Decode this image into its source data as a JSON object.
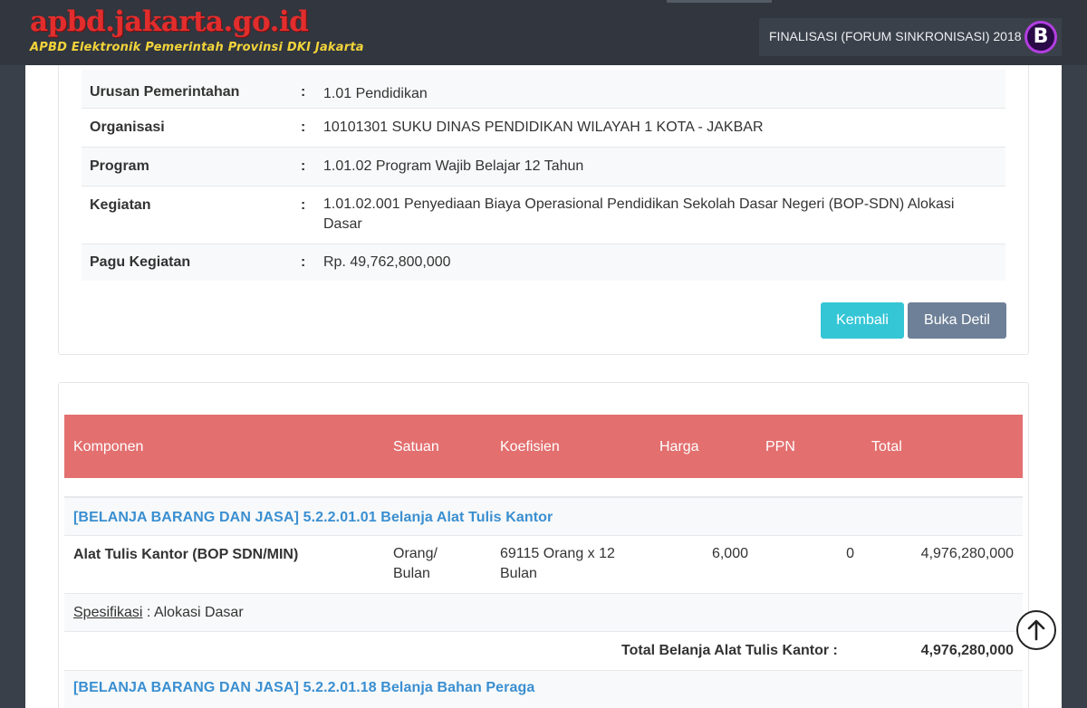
{
  "header": {
    "site_title": "apbd.jakarta.go.id",
    "site_subtitle": "APBD Elektronik Pemerintah Provinsi DKI Jakarta",
    "phase": "FINALISASI (FORUM SINKRONISASI) 2018",
    "badge_letter": "B",
    "colors": {
      "title": "#e22d2d",
      "subtitle": "#f2d43a",
      "badge_ring": "#b23fe0"
    }
  },
  "info": {
    "rows": [
      {
        "label": "Urusan Pemerintahan",
        "separator": ":",
        "value": "1.01 Pendidikan"
      },
      {
        "label": "Organisasi",
        "separator": ":",
        "value": "10101301 SUKU DINAS PENDIDIKAN WILAYAH 1 KOTA - JAKBAR"
      },
      {
        "label": "Program",
        "separator": ":",
        "value": "1.01.02 Program Wajib Belajar 12 Tahun"
      },
      {
        "label": "Kegiatan",
        "separator": ":",
        "value": "1.01.02.001 Penyediaan Biaya Operasional Pendidikan Sekolah Dasar Negeri (BOP-SDN) Alokasi Dasar"
      },
      {
        "label": "Pagu Kegiatan",
        "separator": ":",
        "value": "Rp. 49,762,800,000"
      }
    ]
  },
  "buttons": {
    "kembali": "Kembali",
    "buka_detil": "Buka Detil"
  },
  "table": {
    "header_color": "#e36f6f",
    "columns": [
      "Komponen",
      "Satuan",
      "Koefisien",
      "Harga",
      "PPN",
      "Total"
    ],
    "group1": {
      "title": "[BELANJA BARANG DAN JASA] 5.2.2.01.01 Belanja Alat Tulis Kantor",
      "item": {
        "komponen": "Alat Tulis Kantor (BOP SDN/MIN)",
        "satuan": "Orang/ Bulan",
        "koefisien": "69115 Orang x 12 Bulan",
        "harga": "6,000",
        "ppn": "0",
        "total": "4,976,280,000"
      },
      "spec_label": "Spesifikasi",
      "spec_value": " : Alokasi Dasar",
      "total_label": "Total Belanja Alat Tulis Kantor :",
      "total_value": "4,976,280,000"
    },
    "group2": {
      "title": "[BELANJA BARANG DAN JASA] 5.2.2.01.18 Belanja Bahan Peraga"
    }
  },
  "scroll_top_icon": "arrow-up-circle-icon"
}
